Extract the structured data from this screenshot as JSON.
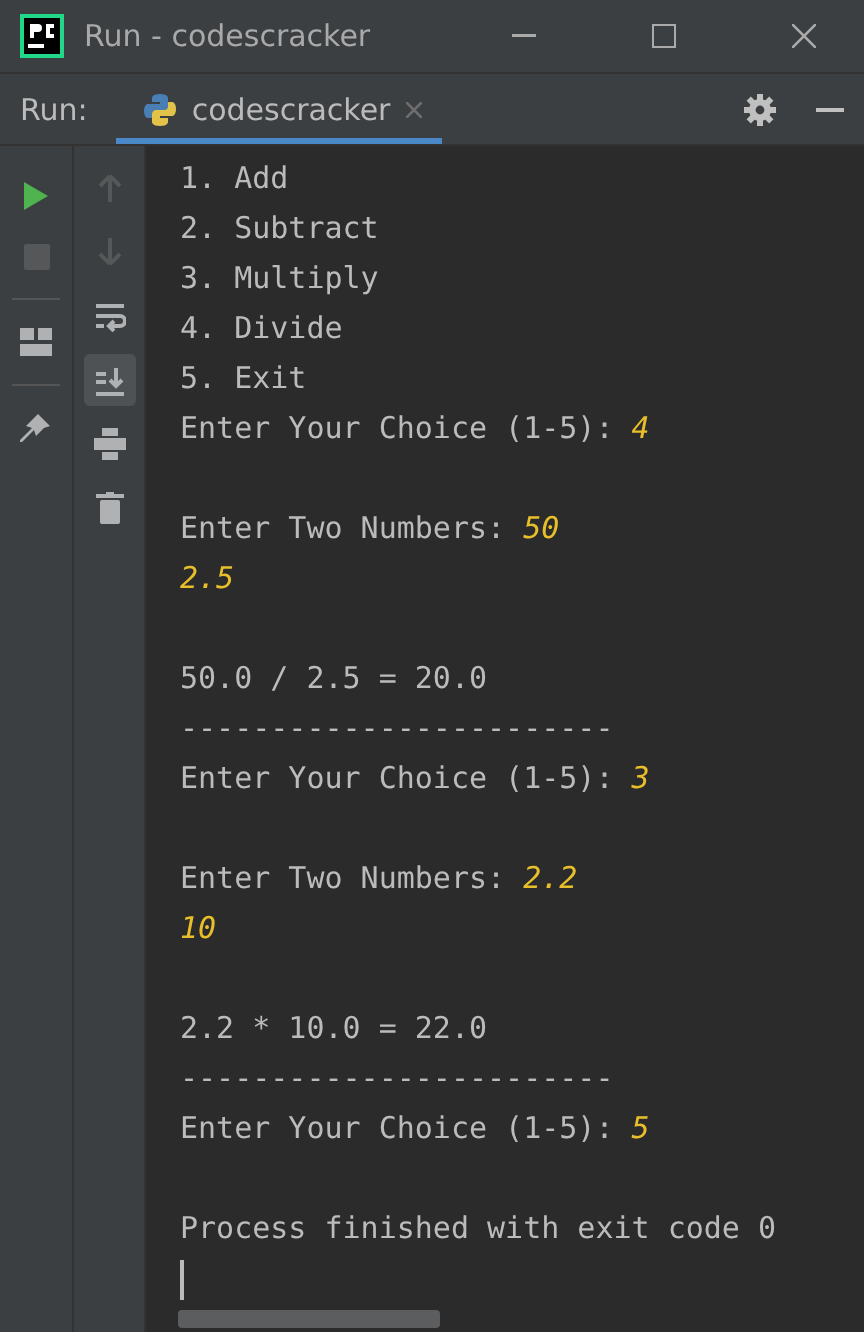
{
  "window": {
    "title": "Run - codescracker"
  },
  "run_bar": {
    "label": "Run:",
    "tabs": [
      {
        "label": "codescracker",
        "selected": true
      }
    ]
  },
  "left_toolbar": [
    {
      "kind": "rerun",
      "disabled": false
    },
    {
      "kind": "stop",
      "disabled": true
    },
    {
      "kind": "layout",
      "disabled": false
    },
    {
      "kind": "pin",
      "disabled": false
    }
  ],
  "console_toolbar": [
    {
      "kind": "up",
      "disabled": true
    },
    {
      "kind": "down",
      "disabled": true
    },
    {
      "kind": "wrap",
      "selected": false
    },
    {
      "kind": "scroll-end",
      "selected": true
    },
    {
      "kind": "print",
      "selected": false
    },
    {
      "kind": "trash",
      "selected": false
    }
  ],
  "console": {
    "lines": [
      {
        "kind": "output",
        "text": "1. Add"
      },
      {
        "kind": "output",
        "text": "2. Subtract"
      },
      {
        "kind": "output",
        "text": "3. Multiply"
      },
      {
        "kind": "output",
        "text": "4. Divide"
      },
      {
        "kind": "output",
        "text": "5. Exit"
      },
      {
        "kind": "prompt",
        "text": "Enter Your Choice (1-5): ",
        "input": "4"
      },
      {
        "kind": "blank"
      },
      {
        "kind": "prompt",
        "text": "Enter Two Numbers: ",
        "input": "50"
      },
      {
        "kind": "input",
        "input": "2.5"
      },
      {
        "kind": "blank"
      },
      {
        "kind": "output",
        "text": "50.0 / 2.5 = 20.0"
      },
      {
        "kind": "output",
        "text": "------------------------"
      },
      {
        "kind": "prompt",
        "text": "Enter Your Choice (1-5): ",
        "input": "3"
      },
      {
        "kind": "blank"
      },
      {
        "kind": "prompt",
        "text": "Enter Two Numbers: ",
        "input": "2.2"
      },
      {
        "kind": "input",
        "input": "10"
      },
      {
        "kind": "blank"
      },
      {
        "kind": "output",
        "text": "2.2 * 10.0 = 22.0"
      },
      {
        "kind": "output",
        "text": "------------------------"
      },
      {
        "kind": "prompt",
        "text": "Enter Your Choice (1-5): ",
        "input": "5"
      },
      {
        "kind": "blank"
      },
      {
        "kind": "output",
        "text": "Process finished with exit code 0"
      }
    ]
  }
}
